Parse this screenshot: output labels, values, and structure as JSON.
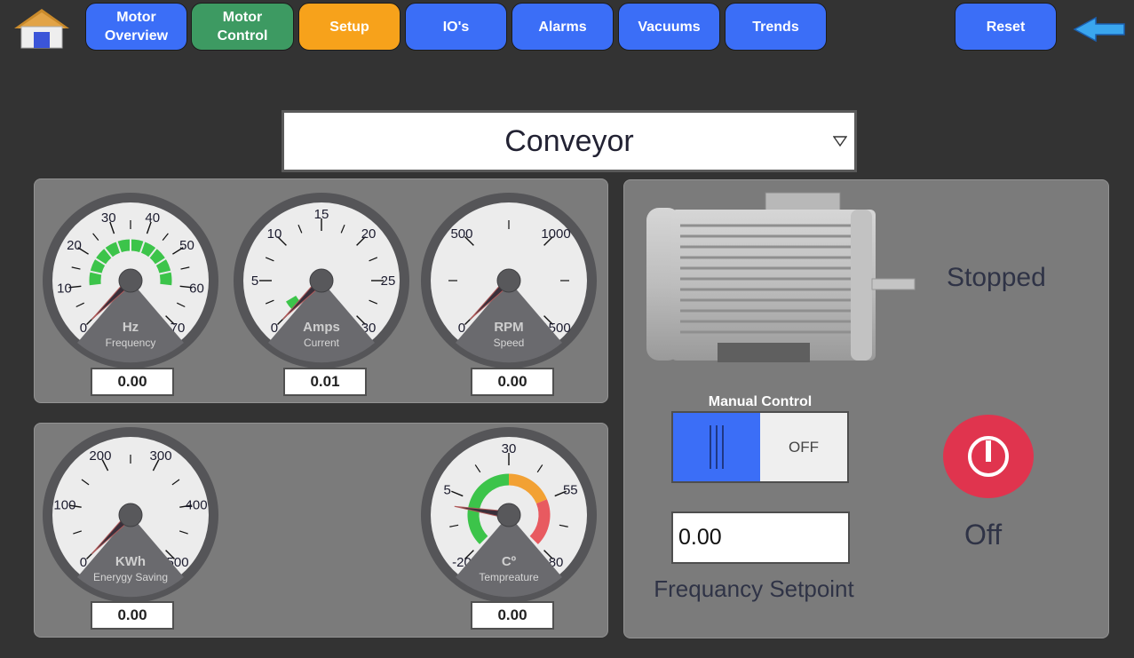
{
  "nav": {
    "buttons": [
      {
        "label": "Motor\nOverview",
        "color": "#3b6ef7"
      },
      {
        "label": "Motor\nControl",
        "color": "#3d9a62"
      },
      {
        "label": "Setup",
        "color": "#f7a21b"
      },
      {
        "label": "IO's",
        "color": "#3b6ef7"
      },
      {
        "label": "Alarms",
        "color": "#3b6ef7"
      },
      {
        "label": "Vacuums",
        "color": "#3b6ef7"
      },
      {
        "label": "Trends",
        "color": "#3b6ef7"
      }
    ],
    "reset_label": "Reset",
    "home_icon": "home-icon",
    "back_icon": "back-arrow-icon"
  },
  "selector": {
    "value": "Conveyor"
  },
  "gauges": [
    {
      "id": "frequency",
      "unit": "Hz",
      "caption": "Frequency",
      "min": 0,
      "max": 70,
      "ticks": [
        "0",
        "10",
        "20",
        "30",
        "40",
        "50",
        "60",
        "70"
      ],
      "value": 0.0,
      "readout": "0.00",
      "bands": [
        {
          "from": 10,
          "to": 60,
          "color": "#3cc44a",
          "style": "segmented"
        }
      ]
    },
    {
      "id": "current",
      "unit": "Amps",
      "caption": "Current",
      "min": 0,
      "max": 30,
      "ticks": [
        "0",
        "5",
        "10",
        "15",
        "20",
        "25",
        "30"
      ],
      "value": 0.01,
      "readout": "0.01",
      "bands": [
        {
          "from": 0,
          "to": 1.6,
          "color": "#3cc44a",
          "style": "solid"
        }
      ]
    },
    {
      "id": "speed",
      "unit": "RPM",
      "caption": "Speed",
      "min": 0,
      "max": 1500,
      "ticks": [
        "0",
        "500",
        "1000",
        "1500"
      ],
      "value": 0.0,
      "readout": "0.00",
      "bands": []
    },
    {
      "id": "energy",
      "unit": "KWh",
      "caption": "Enerygy Saving",
      "min": 0,
      "max": 500,
      "ticks": [
        "0",
        "100",
        "200",
        "300",
        "400",
        "500"
      ],
      "value": 0.0,
      "readout": "0.00",
      "bands": []
    },
    {
      "id": "temperature",
      "unit": "Cº",
      "caption": "Tempreature",
      "min": -20,
      "max": 80,
      "ticks": [
        "-20",
        "5",
        "30",
        "55",
        "80"
      ],
      "value": 0.0,
      "readout": "0.00",
      "bands": [
        {
          "from": -20,
          "to": 30,
          "color": "#3cc44a",
          "style": "solid"
        },
        {
          "from": 30,
          "to": 55,
          "color": "#f2a134",
          "style": "solid"
        },
        {
          "from": 55,
          "to": 80,
          "color": "#e85a60",
          "style": "solid"
        }
      ]
    }
  ],
  "motor": {
    "status": "Stopped",
    "icon": "motor-icon"
  },
  "manual_control": {
    "label": "Manual Control",
    "state": "OFF"
  },
  "setpoint": {
    "value": "0.00",
    "label": "Frequancy Setpoint"
  },
  "power": {
    "state_label": "Off",
    "icon": "power-icon",
    "color": "#e0344e"
  }
}
